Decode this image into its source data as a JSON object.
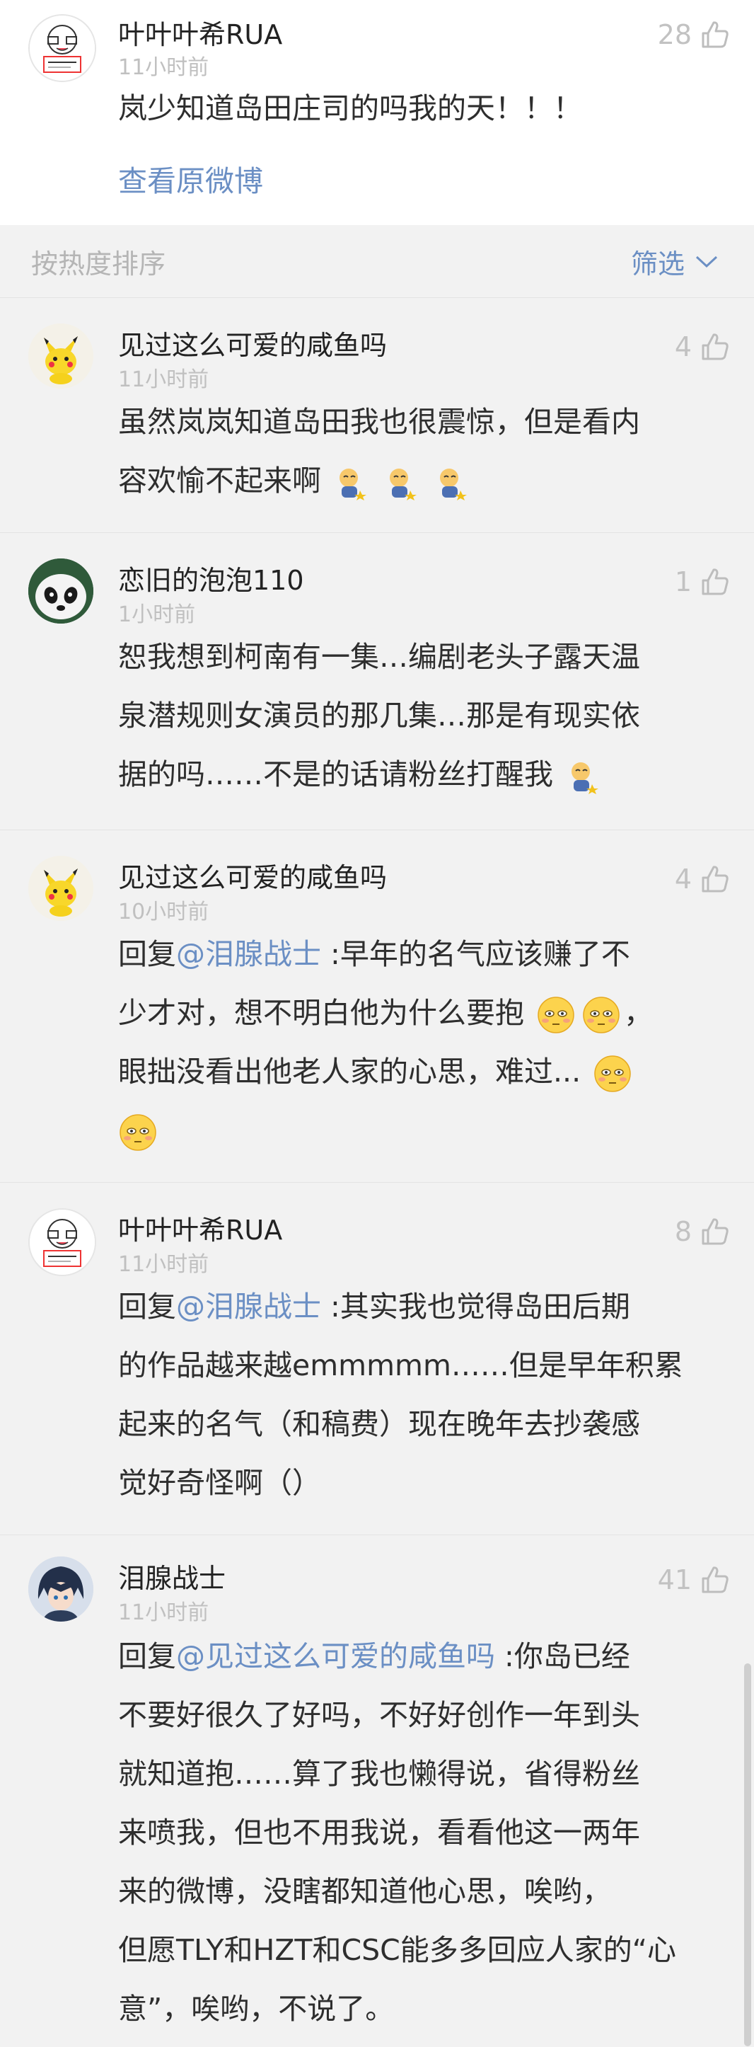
{
  "top_comment": {
    "username": "叶叶叶希RUA",
    "time": "11小时前",
    "likes": "28",
    "text": "岚少知道岛田庄司的吗我的天！！！",
    "view_original": "查看原微博"
  },
  "sort_bar": {
    "sort_label": "按热度排序",
    "filter_label": "筛选"
  },
  "comments": [
    {
      "username": "见过这么可爱的咸鱼吗",
      "time": "11小时前",
      "likes": "4",
      "line1": "虽然岚岚知道岛田我也很震惊，但是看内",
      "line2": "容欢愉不起来啊"
    },
    {
      "username": "恋旧的泡泡110",
      "time": "1小时前",
      "likes": "1",
      "line1": "恕我想到柯南有一集…编剧老头子露天温",
      "line2": "泉潜规则女演员的那几集…那是有现实依",
      "line3": "据的吗……不是的话请粉丝打醒我"
    },
    {
      "username": "见过这么可爱的咸鱼吗",
      "time": "10小时前",
      "likes": "4",
      "reply_prefix": "回复",
      "mention": "@泪腺战士",
      "line1_rest": " :早年的名气应该赚了不",
      "line2": "少才对，想不明白他为什么要抱",
      "line2_tail": "，",
      "line3": "眼拙没看出他老人家的心思，难过..."
    },
    {
      "username": "叶叶叶希RUA",
      "time": "11小时前",
      "likes": "8",
      "reply_prefix": "回复",
      "mention": "@泪腺战士",
      "line1_rest": " :其实我也觉得岛田后期",
      "line2": "的作品越来越emmmmm……但是早年积累",
      "line3": "起来的名气（和稿费）现在晚年去抄袭感",
      "line4": "觉好奇怪啊（）"
    },
    {
      "username": "泪腺战士",
      "time": "11小时前",
      "likes": "41",
      "reply_prefix": "回复",
      "mention": "@见过这么可爱的咸鱼吗",
      "line1_rest": " :你岛已经",
      "line2": "不要好很久了好吗，不好好创作一年到头",
      "line3": "就知道抱……算了我也懒得说，省得粉丝",
      "line4": "来喷我，但也不用我说，看看他这一两年",
      "line5": "来的微博，没瞎都知道他心思，唉哟，",
      "line6": "但愿TLY和HZT和CSC能多多回应人家的“心",
      "line7": "意”，唉哟，不说了。"
    }
  ],
  "icons": {
    "thumb": "thumbs-up-icon",
    "chevron": "chevron-down-icon"
  },
  "colors": {
    "link": "#6b8fc4",
    "background": "#f2f2f2",
    "card": "#ffffff"
  }
}
